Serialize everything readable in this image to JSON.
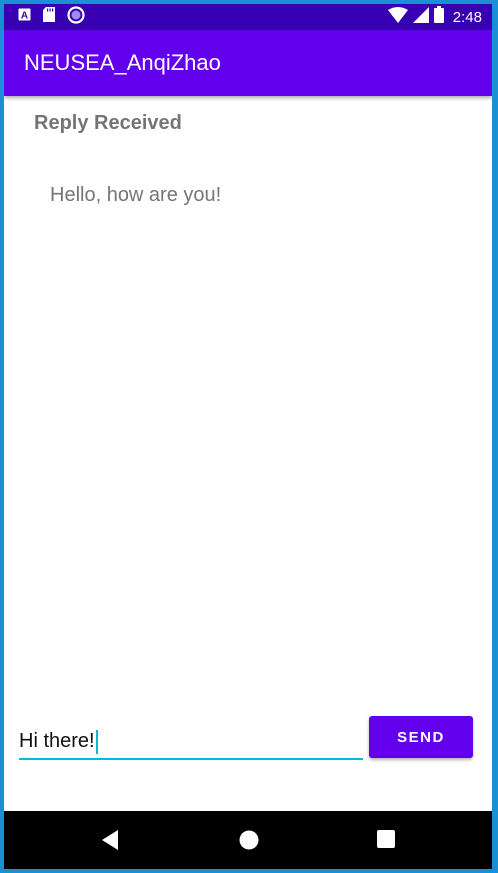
{
  "status_bar": {
    "time": "2:48",
    "icons": [
      "app-a-icon",
      "sd-card-icon",
      "sync-circle-icon",
      "wifi-icon",
      "cell-signal-icon",
      "battery-icon"
    ]
  },
  "app_bar": {
    "title": "NEUSEA_AnqiZhao"
  },
  "main": {
    "reply_header": "Reply Received",
    "reply_message": "Hello, how are you!",
    "message_input_value": "Hi there!",
    "send_label": "SEND"
  },
  "nav_bar": {
    "icons": [
      "back-icon",
      "home-icon",
      "recents-icon"
    ]
  },
  "colors": {
    "status_bar": "#3700b3",
    "app_bar": "#6200ee",
    "accent": "#00bcd4",
    "button": "#6200ee",
    "secondary_text": "#757575"
  }
}
